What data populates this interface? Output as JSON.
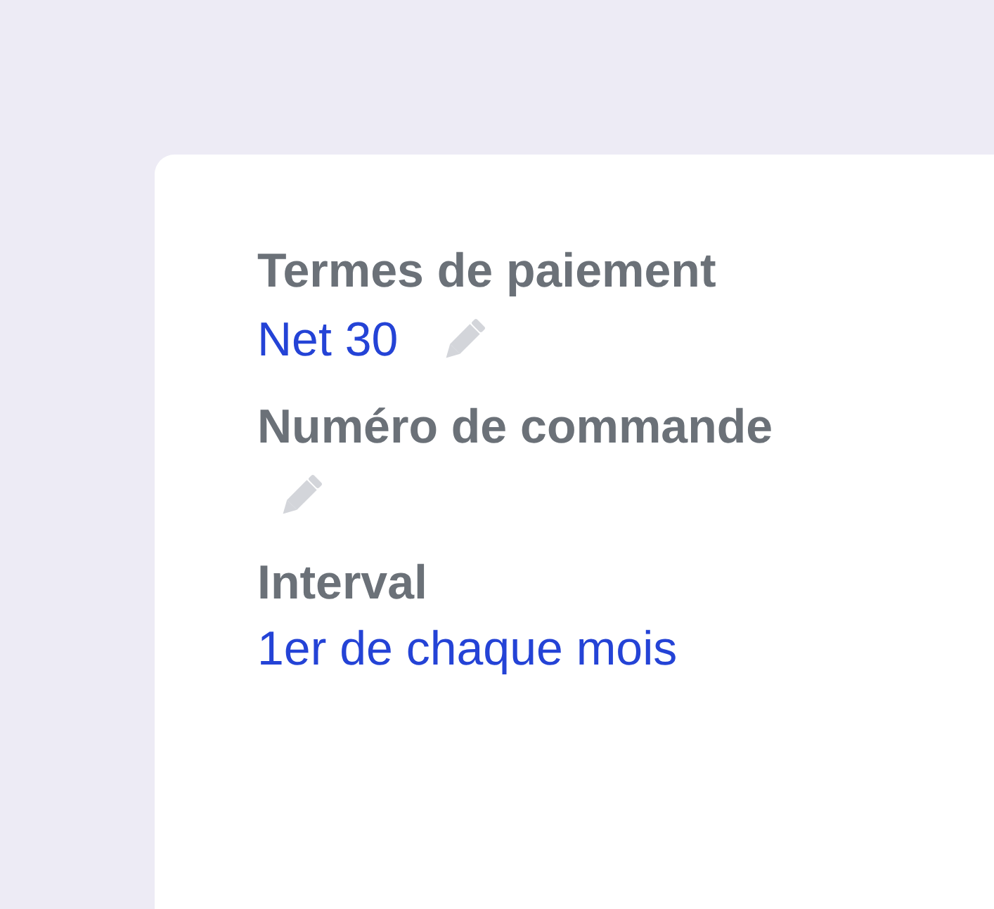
{
  "fields": [
    {
      "label": "Termes de paiement",
      "value": "Net 30",
      "editable": true
    },
    {
      "label": "Numéro de commande",
      "editable": true
    },
    {
      "label": "Interval",
      "value": "1er de chaque mois",
      "editable": false
    }
  ]
}
